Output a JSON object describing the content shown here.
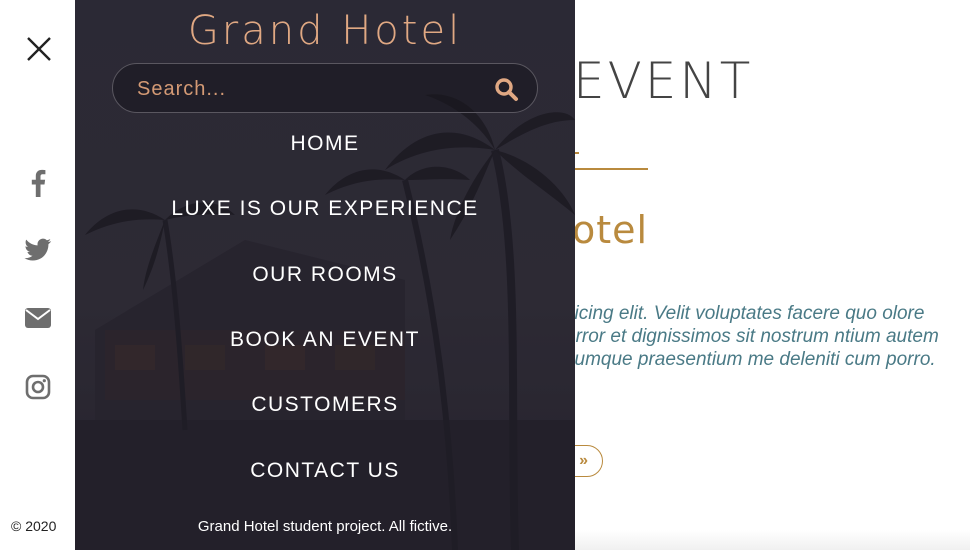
{
  "menu": {
    "brand": "Grand Hotel",
    "search": {
      "placeholder": "Search...",
      "value": ""
    },
    "items": [
      {
        "label": "HOME"
      },
      {
        "label": "LUXE IS OUR EXPERIENCE"
      },
      {
        "label": "OUR ROOMS"
      },
      {
        "label": "BOOK AN EVENT"
      },
      {
        "label": "CUSTOMERS"
      },
      {
        "label": "CONTACT US"
      }
    ],
    "footer": "Grand Hotel student project. All fictive."
  },
  "rail": {
    "close_icon": "close-icon",
    "social": [
      "facebook-icon",
      "twitter-icon",
      "envelope-icon",
      "instagram-icon"
    ],
    "icon_color": "#6e6e6e",
    "copyright": "© 2020"
  },
  "background_page": {
    "heading": "EVENT",
    "subheading": "otel",
    "paragraph": "sicing elit. Velit voluptates facere quo olore error et dignissimos sit nostrum ntium autem cumque praesentium me deleniti cum porro.",
    "button_label": "»"
  },
  "colors": {
    "accent": "#e0a883",
    "gold": "#b98a3e",
    "menu_bg": "#2a2834",
    "teal_text": "#4a7a86"
  }
}
